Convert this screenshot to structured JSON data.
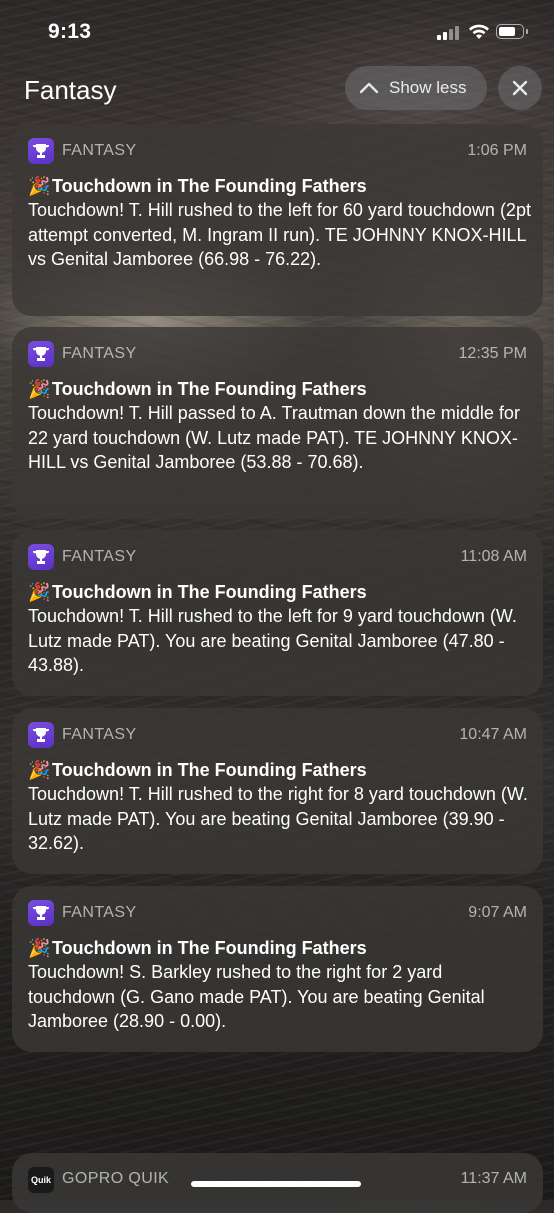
{
  "status_bar": {
    "time": "9:13",
    "signal_icon": "cellular-signal-icon",
    "wifi_icon": "wifi-icon",
    "battery_icon": "battery-icon",
    "battery_level": 0.75
  },
  "group": {
    "title": "Fantasy",
    "show_less_label": "Show less",
    "show_less_icon": "chevron-up-icon",
    "close_icon": "close-icon"
  },
  "notifications": [
    {
      "app_name": "FANTASY",
      "time": "1:06 PM",
      "emoji": "🎉",
      "title": "Touchdown in The Founding Fathers",
      "body": "Touchdown! T. Hill rushed to the left for 60 yard touchdown (2pt attempt converted, M. Ingram II run). TE JOHNNY KNOX-HILL vs Genital Jamboree (66.98 - 76.22)."
    },
    {
      "app_name": "FANTASY",
      "time": "12:35 PM",
      "emoji": "🎉",
      "title": "Touchdown in The Founding Fathers",
      "body": "Touchdown! T. Hill passed to A. Trautman down the middle for 22 yard touchdown (W. Lutz made PAT). TE JOHNNY KNOX-HILL vs Genital Jamboree (53.88 - 70.68)."
    },
    {
      "app_name": "FANTASY",
      "time": "11:08 AM",
      "emoji": "🎉",
      "title": "Touchdown in The Founding Fathers",
      "body": "Touchdown! T. Hill rushed to the left for 9 yard touchdown (W. Lutz made PAT). You are beating Genital Jamboree (47.80 - 43.88)."
    },
    {
      "app_name": "FANTASY",
      "time": "10:47 AM",
      "emoji": "🎉",
      "title": "Touchdown in The Founding Fathers",
      "body": "Touchdown! T. Hill rushed to the right for 8 yard touchdown (W. Lutz made PAT). You are beating Genital Jamboree (39.90 - 32.62)."
    },
    {
      "app_name": "FANTASY",
      "time": "9:07 AM",
      "emoji": "🎉",
      "title": "Touchdown in The Founding Fathers",
      "body": "Touchdown! S. Barkley rushed to the right for 2 yard touchdown (G. Gano made PAT). You are beating Genital Jamboree (28.90 - 0.00)."
    }
  ],
  "gopro_notification": {
    "icon_text": "Quik",
    "app_name": "GOPRO QUIK",
    "time": "11:37 AM"
  }
}
